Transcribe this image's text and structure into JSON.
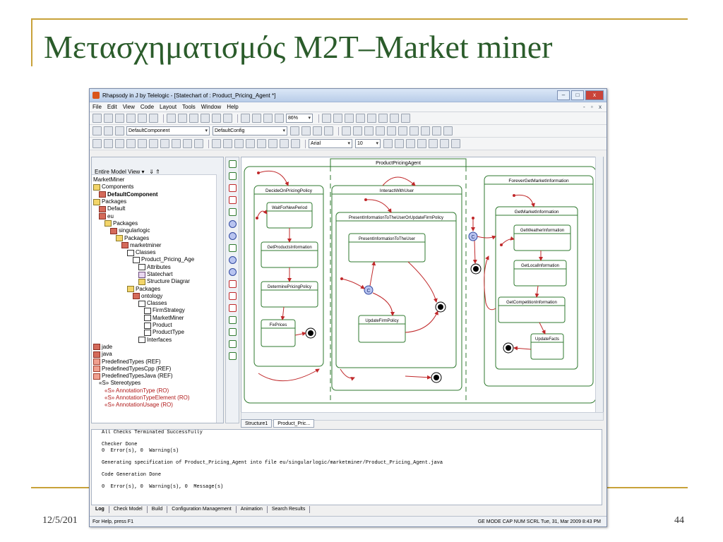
{
  "slide": {
    "title": "Μετασχηματισμός M2T–Market miner",
    "date": "12/5/201",
    "page_number": "44"
  },
  "window": {
    "title": "Rhapsody in J by Telelogic - [Statechart of : Product_Pricing_Agent *]",
    "minimize": "–",
    "maximize": "□",
    "close": "x"
  },
  "menu": [
    "File",
    "Edit",
    "View",
    "Code",
    "Layout",
    "Tools",
    "Window",
    "Help"
  ],
  "toolbar": {
    "zoom": "86%",
    "component": "DefaultComponent",
    "config": "DefaultConfig",
    "font": "Arial",
    "font_size": "10"
  },
  "browser": {
    "view_selector": "Entire Model View",
    "tree": [
      {
        "label": "MarketMiner",
        "indent": 0,
        "icon": "none"
      },
      {
        "label": "Components",
        "indent": 0,
        "icon": "folder"
      },
      {
        "label": "DefaultComponent",
        "indent": 1,
        "icon": "pkg",
        "bold": true
      },
      {
        "label": "Packages",
        "indent": 0,
        "icon": "folder"
      },
      {
        "label": "Default",
        "indent": 1,
        "icon": "pkg"
      },
      {
        "label": "eu",
        "indent": 1,
        "icon": "pkg"
      },
      {
        "label": "Packages",
        "indent": 2,
        "icon": "folder"
      },
      {
        "label": "singularlogic",
        "indent": 3,
        "icon": "pkg"
      },
      {
        "label": "Packages",
        "indent": 4,
        "icon": "folder"
      },
      {
        "label": "marketminer",
        "indent": 5,
        "icon": "pkg"
      },
      {
        "label": "Classes",
        "indent": 6,
        "icon": "cls"
      },
      {
        "label": "Product_Pricing_Age",
        "indent": 7,
        "icon": "cls"
      },
      {
        "label": "Attributes",
        "indent": 8,
        "icon": "cls"
      },
      {
        "label": "Statechart",
        "indent": 8,
        "icon": "st"
      },
      {
        "label": "Structure Diagrar",
        "indent": 8,
        "icon": "folder"
      },
      {
        "label": "Packages",
        "indent": 6,
        "icon": "folder"
      },
      {
        "label": "ontology",
        "indent": 7,
        "icon": "pkg"
      },
      {
        "label": "Classes",
        "indent": 8,
        "icon": "cls"
      },
      {
        "label": "FirmStrategy",
        "indent": 9,
        "icon": "cls"
      },
      {
        "label": "MarketMiner",
        "indent": 9,
        "icon": "cls"
      },
      {
        "label": "Product",
        "indent": 9,
        "icon": "cls"
      },
      {
        "label": "ProductType",
        "indent": 9,
        "icon": "cls"
      },
      {
        "label": "Interfaces",
        "indent": 8,
        "icon": "cls"
      },
      {
        "label": "jade",
        "indent": 0,
        "icon": "pkg"
      },
      {
        "label": "java",
        "indent": 0,
        "icon": "pkg"
      },
      {
        "label": "PredefinedTypes (REF)",
        "indent": 0,
        "icon": "ref"
      },
      {
        "label": "PredefinedTypesCpp (REF)",
        "indent": 0,
        "icon": "ref"
      },
      {
        "label": "PredefinedTypesJava (REF)",
        "indent": 0,
        "icon": "ref"
      },
      {
        "label": "«S» Stereotypes",
        "indent": 1,
        "icon": "none"
      },
      {
        "label": "«S» AnnotationType (RO)",
        "indent": 2,
        "icon": "none",
        "red": true
      },
      {
        "label": "«S» AnnotationTypeElement (RO)",
        "indent": 2,
        "icon": "none",
        "red": true
      },
      {
        "label": "«S» AnnotationUsage (RO)",
        "indent": 2,
        "icon": "none",
        "red": true
      }
    ]
  },
  "diagram": {
    "agent_label": "ProductPricingAgent",
    "regions": [
      {
        "title": "DecideOnPricingPolicy",
        "states": [
          "WaitForNewPeriod",
          "GetProductsInformation",
          "DeterminePricingPolicy",
          "FixPrices"
        ]
      },
      {
        "title": "InteractWithUser",
        "inner_title": "PresentInformationToTheUserOrUpdateFirmPolicy",
        "states": [
          "PresentInformationToTheUser",
          "UpdateFirmPolicy"
        ],
        "connector": "C"
      },
      {
        "title": "ForeverGetMarketInformation",
        "inner_title": "GetMarketInformation",
        "states": [
          "GetWeatherInformation",
          "GetLocalInformation",
          "GetCompetitionInformation",
          "UpdateFacts"
        ],
        "connector": "C"
      }
    ]
  },
  "diagram_tabs": [
    "Structure1",
    "Product_Pric..."
  ],
  "output": {
    "lines": [
      "All Checks Terminated Successfully",
      "",
      "Checker Done",
      "0  Error(s), 0  Warning(s)",
      "",
      "Generating specification of Product_Pricing_Agent into file eu/singularlogic/marketminer/Product_Pricing_Agent.java",
      "",
      "Code Generation Done",
      "",
      "0  Error(s), 0  Warning(s), 0  Message(s)"
    ],
    "tabs": [
      "Log",
      "Check Model",
      "Build",
      "Configuration Management",
      "Animation",
      "Search Results"
    ]
  },
  "status": {
    "left": "For Help, press F1",
    "right": "GE MODE  CAP  NUM  SCRL  Tue, 31, Mar 2009   8:43  PM"
  },
  "colors": {
    "title_green": "#2b5c2b",
    "accent_gold": "#c8a23a",
    "state_green": "#2f7a2f",
    "transition_red": "#c0282a"
  }
}
